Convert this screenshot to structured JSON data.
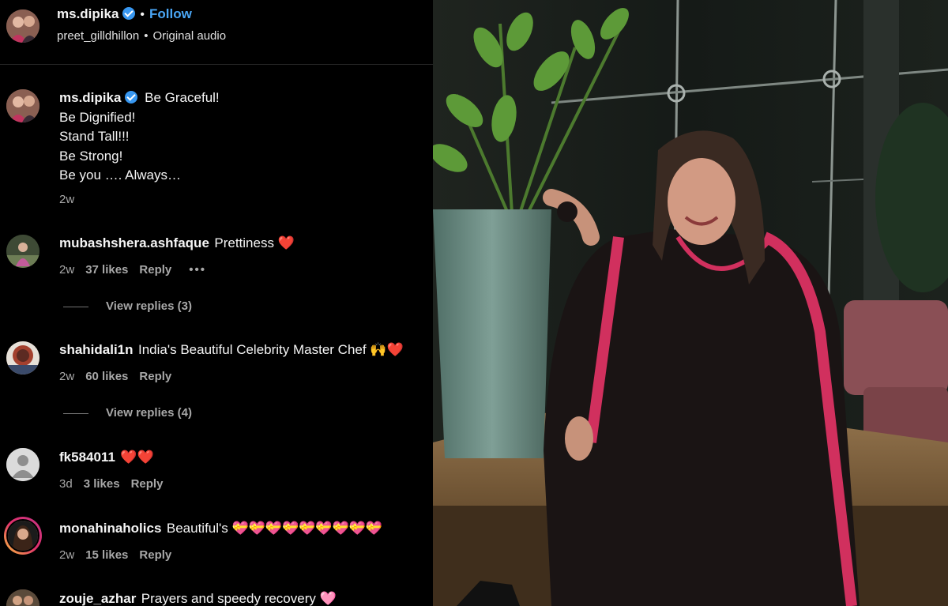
{
  "post": {
    "author": "ms.dipika",
    "follow_label": "Follow",
    "audio_user": "preet_gilldhillon",
    "audio_label": "Original audio"
  },
  "caption": {
    "username": "ms.dipika",
    "lines": [
      "Be Graceful!",
      "Be Dignified!",
      "Stand Tall!!!",
      "Be Strong!",
      "Be you …. Always…"
    ],
    "time": "2w"
  },
  "comments": [
    {
      "username": "mubashshera.ashfaque",
      "text": "Prettiness ❤️",
      "time": "2w",
      "likes": "37 likes",
      "reply": "Reply",
      "more": "•••",
      "view_replies": "View replies (3)"
    },
    {
      "username": "shahidali1n",
      "text": "India's Beautiful Celebrity Master Chef 🙌❤️",
      "time": "2w",
      "likes": "60 likes",
      "reply": "Reply",
      "view_replies": "View replies (4)"
    },
    {
      "username": "fk584011",
      "text": "❤️❤️",
      "time": "3d",
      "likes": "3 likes",
      "reply": "Reply"
    },
    {
      "username": "monahinaholics",
      "text": "Beautiful's 💝💝💝💝💝💝💝💝💝",
      "time": "2w",
      "likes": "15 likes",
      "reply": "Reply"
    },
    {
      "username": "zouje_azhar",
      "text": "Prayers and speedy recovery 🩷"
    }
  ],
  "colors": {
    "accent": "#4aa6f5",
    "verified": "#3897f0",
    "background": "#000000",
    "muted": "#a8a8a8"
  }
}
